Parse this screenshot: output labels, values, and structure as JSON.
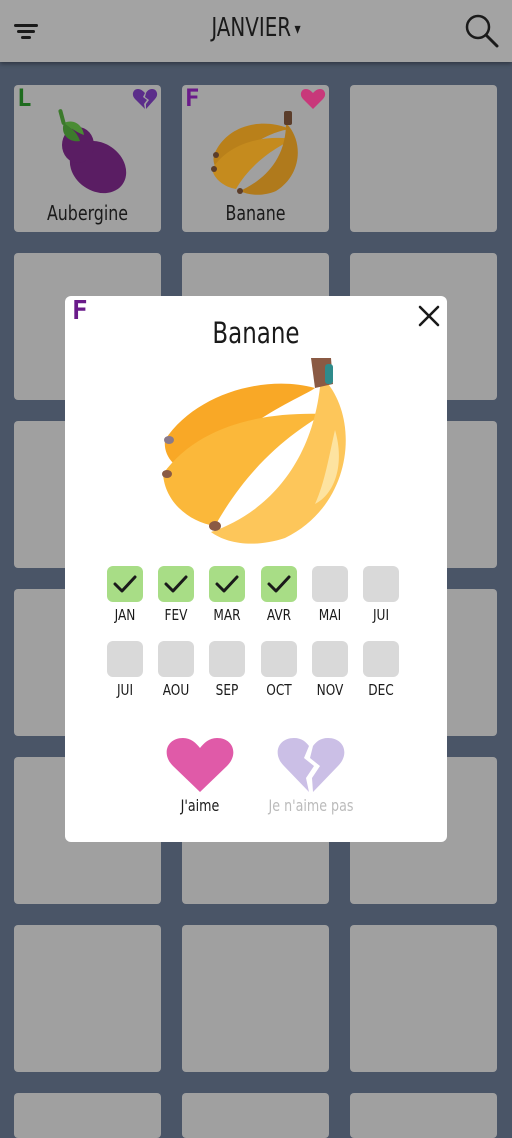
{
  "header": {
    "month": "JANVIER",
    "month_caret": "▾",
    "filter_icon": "filter-lines-icon",
    "search_icon": "search-icon"
  },
  "grid": {
    "tiles": [
      {
        "name": "Aubergine",
        "tag": "L",
        "favorite": "broken-heart",
        "image": "eggplant"
      },
      {
        "name": "Banane",
        "tag": "F",
        "favorite": "heart",
        "image": "bananas"
      }
    ]
  },
  "modal": {
    "tag": "F",
    "title": "Banane",
    "close_icon": "close-icon",
    "months": [
      {
        "label": "JAN",
        "in_season": true
      },
      {
        "label": "FEV",
        "in_season": true
      },
      {
        "label": "MAR",
        "in_season": true
      },
      {
        "label": "AVR",
        "in_season": true
      },
      {
        "label": "MAI",
        "in_season": false
      },
      {
        "label": "JUI",
        "in_season": false
      },
      {
        "label": "JUI",
        "in_season": false
      },
      {
        "label": "AOU",
        "in_season": false
      },
      {
        "label": "SEP",
        "in_season": false
      },
      {
        "label": "OCT",
        "in_season": false
      },
      {
        "label": "NOV",
        "in_season": false
      },
      {
        "label": "DEC",
        "in_season": false
      }
    ],
    "like_label": "J'aime",
    "dislike_label": "Je n'aime pas"
  },
  "colors": {
    "background": "#4a5567",
    "header": "#a3a3a3",
    "tile": "#a0a0a0",
    "in_season": "#a8dd86",
    "off_season": "#d9d9d9",
    "heart": "#e05aa8",
    "broken_heart": "#cbbfe6",
    "tag_legume": "#1e6b1e",
    "tag_fruit": "#6a1b8a"
  }
}
